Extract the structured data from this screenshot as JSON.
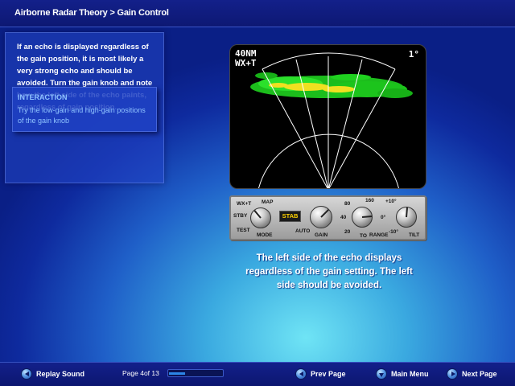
{
  "header": {
    "title": "Airborne Radar Theory > Gain Control"
  },
  "left_panel": {
    "body_text": "If an echo is displayed regardless of the gain position, it is most likely a very strong echo and should be avoided.  Turn the gain knob and note how the left side of the echo paints, regardless of gain position.",
    "interaction_heading": "INTERACTION",
    "interaction_text": "Try the low-gain and high-gain positions of the gain knob"
  },
  "radar": {
    "range_label": "40NM",
    "mode_label": "WX+T",
    "tilt_readout": "1°"
  },
  "control_panel": {
    "mode_labels": {
      "wxt": "WX+T",
      "map": "MAP",
      "stby": "STBY",
      "test": "TEST",
      "mode": "MODE"
    },
    "stab_button": "STAB",
    "gain_labels": {
      "auto": "AUTO",
      "gain": "GAIN"
    },
    "range_labels": {
      "r80": "80",
      "r160": "160",
      "r40": "40",
      "r20": "20",
      "to": "TO",
      "range": "RANGE"
    },
    "tilt_labels": {
      "plus10": "+10°",
      "zero": "0°",
      "minus10": "-10°",
      "tilt": "TILT"
    }
  },
  "caption": "The left side of the echo displays regardless of the gain setting.  The left side should be avoided.",
  "footer": {
    "replay_label": "Replay Sound",
    "page_indicator": "Page 4of 13",
    "progress_fraction": 0.31,
    "prev_label": "Prev Page",
    "main_menu_label": "Main Menu",
    "next_label": "Next Page"
  },
  "colors": {
    "background_dark": "#0a1f86",
    "background_glow": "#6fe4f5",
    "interaction_text": "#8fc3ff",
    "radar_green": "#1fd11f",
    "radar_yellow": "#f0e020",
    "stab_text": "#ffd200"
  }
}
